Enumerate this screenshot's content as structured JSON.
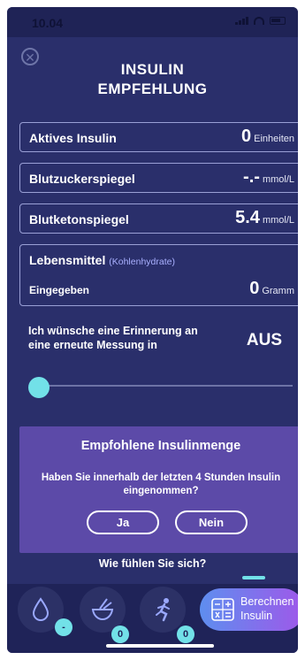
{
  "status_bar": {
    "time": "10.04"
  },
  "header": {
    "title_line1": "INSULIN",
    "title_line2": "EMPFEHLUNG"
  },
  "cards": {
    "active_insulin": {
      "label": "Aktives Insulin",
      "value": "0",
      "unit": "Einheiten"
    },
    "blood_sugar": {
      "label": "Blutzuckerspiegel",
      "value": "-.-",
      "unit": "mmol/L"
    },
    "blood_ketone": {
      "label": "Blutketonspiegel",
      "value": "5.4",
      "unit": "mmol/L"
    },
    "food": {
      "label": "Lebensmittel",
      "sublabel": "(Kohlenhydrate)",
      "entered_label": "Eingegeben",
      "value": "0",
      "unit": "Gramm"
    }
  },
  "reminder": {
    "label": "Ich wünsche eine Erinnerung an eine erneute Messung in",
    "value": "AUS",
    "slider_fraction": 0
  },
  "recommendation": {
    "title": "Empfohlene Insulinmenge",
    "question": "Haben Sie innerhalb der letzten 4 Stunden Insulin eingenommen?",
    "yes_label": "Ja",
    "no_label": "Nein"
  },
  "feeling_prompt": "Wie fühlen Sie sich?",
  "bottom_bar": {
    "drop_badge": "-",
    "food_badge": "0",
    "activity_badge": "0",
    "calculate_line1": "Berechnen",
    "calculate_line2": "Insulin"
  },
  "colors": {
    "background": "#2a2f6b",
    "accent": "#72e1e8",
    "panel": "#5c4aa8"
  }
}
